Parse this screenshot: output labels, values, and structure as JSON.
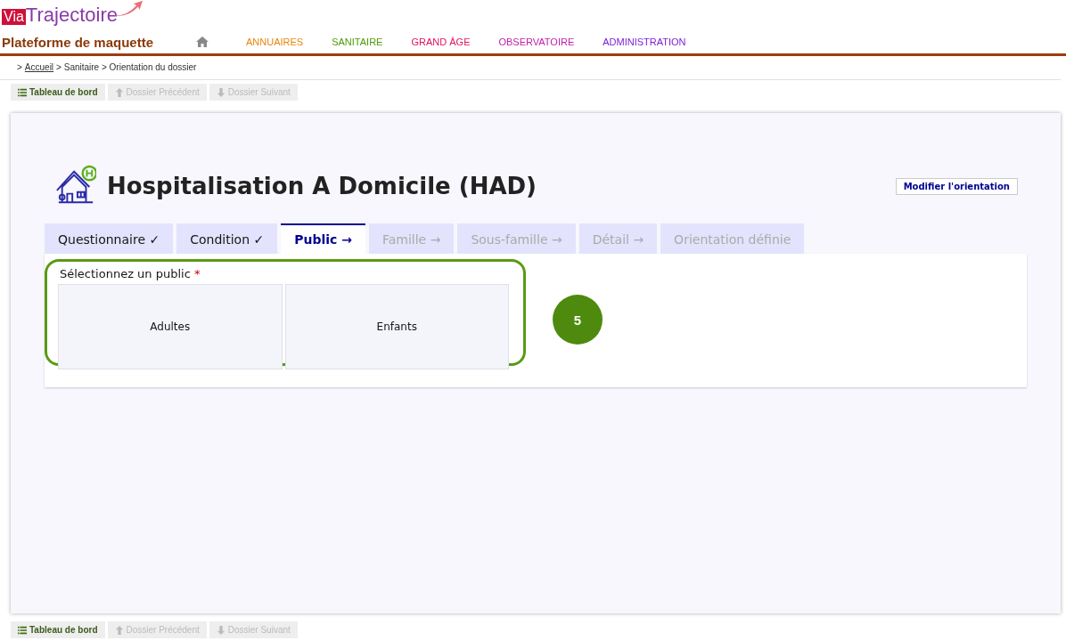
{
  "logo": {
    "part_1": "Via",
    "part_2": "Trajectoire"
  },
  "platform_title": "Plateforme de maquette",
  "nav": [
    {
      "label": "ANNUAIRES",
      "color": "#e8850c"
    },
    {
      "label": "SANITAIRE",
      "color": "#4e9a06"
    },
    {
      "label": "GRAND ÂGE",
      "color": "#e0115f"
    },
    {
      "label": "OBSERVATOIRE",
      "color": "#c020a8"
    },
    {
      "label": "ADMINISTRATION",
      "color": "#7a1fd6"
    }
  ],
  "breadcrumb": {
    "prefix": ">",
    "link": "Accueil",
    "rest": "> Sanitaire > Orientation du dossier"
  },
  "toolbar_top": [
    {
      "label": "Tableau de bord",
      "kind": "dashboard",
      "disabled": false
    },
    {
      "label": "Dossier Précédent",
      "kind": "up",
      "disabled": true
    },
    {
      "label": "Dossier Suivant",
      "kind": "down",
      "disabled": true
    }
  ],
  "page_title": "Hospitalisation A Domicile (HAD)",
  "modify_button": "Modifier l'orientation",
  "tabs": [
    {
      "label": "Questionnaire ✓",
      "selected": false,
      "disabled": false
    },
    {
      "label": "Condition ✓",
      "selected": false,
      "disabled": false
    },
    {
      "label": "Public →",
      "selected": true,
      "disabled": false
    },
    {
      "label": "Famille →",
      "selected": false,
      "disabled": true
    },
    {
      "label": "Sous-famille →",
      "selected": false,
      "disabled": true
    },
    {
      "label": "Détail →",
      "selected": false,
      "disabled": true
    },
    {
      "label": "Orientation définie",
      "selected": false,
      "disabled": true
    }
  ],
  "question": {
    "label": "Sélectionnez un public",
    "required_mark": "*"
  },
  "options": [
    {
      "label": "Adultes",
      "selected": false
    },
    {
      "label": "Enfants",
      "selected": false
    }
  ],
  "step_badge": "5",
  "toolbar_bottom": [
    {
      "label": "Tableau de bord",
      "kind": "dashboard",
      "disabled": false
    },
    {
      "label": "Dossier Précédent",
      "kind": "up",
      "disabled": true
    },
    {
      "label": "Dossier Suivant",
      "kind": "down",
      "disabled": true
    }
  ]
}
